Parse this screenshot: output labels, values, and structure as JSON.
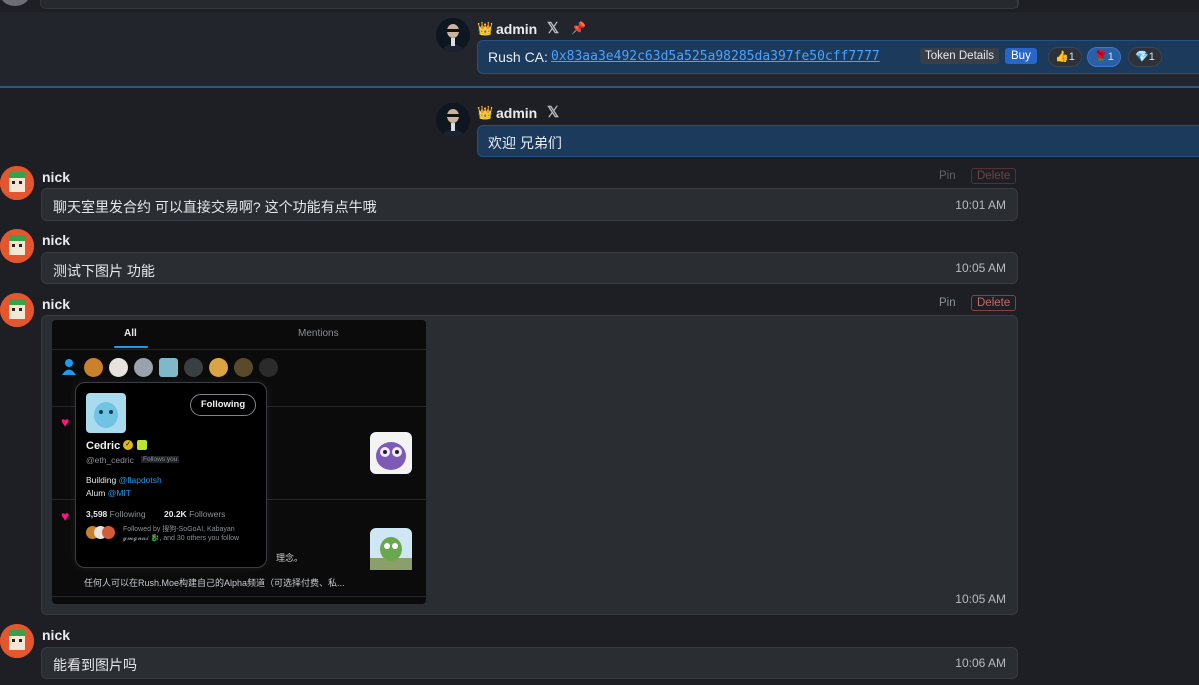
{
  "colors": {
    "background": "#1d1f24",
    "admin_bubble": "#1c3a5c",
    "message_bubble": "#2a2d32",
    "link": "#4aa3ff",
    "buy_button": "#2867c9",
    "delete_red": "#c46b6b",
    "pin_marker": "#e2424e"
  },
  "icons": {
    "crown": "crown-icon",
    "x": "x-logo-icon",
    "pin": "pin-icon"
  },
  "messages": {
    "pinned": {
      "author": "admin",
      "crown": "👑",
      "x_glyph": "𝕏",
      "pin_glyph": "📌",
      "ca_label": "Rush CA:",
      "ca_address": "0x83aa3e492c63d5a525a98285da397fe50cff7777",
      "token_details_label": "Token Details",
      "buy_label": "Buy",
      "reactions": [
        {
          "emoji": "👍",
          "count": "1"
        },
        {
          "emoji": "🌹",
          "count": "1"
        },
        {
          "emoji": "💎",
          "count": "1"
        }
      ]
    },
    "welcome": {
      "author": "admin",
      "crown": "👑",
      "x_glyph": "𝕏",
      "text": "欢迎 兄弟们"
    },
    "nick1": {
      "author": "nick",
      "text": "聊天室里发合约 可以直接交易啊?  这个功能有点牛哦",
      "time": "10:01 AM",
      "pin_label": "Pin",
      "delete_label": "Delete"
    },
    "nick2": {
      "author": "nick",
      "text": "测试下图片 功能",
      "time": "10:05 AM"
    },
    "nick3": {
      "author": "nick",
      "time": "10:05 AM",
      "pin_label": "Pin",
      "delete_label": "Delete"
    },
    "nick4": {
      "author": "nick",
      "text": "能看到图片吗",
      "time": "10:06 AM"
    }
  },
  "embedded_image": {
    "tabs": [
      "All",
      "Mentions"
    ],
    "profile": {
      "name": "Cedric",
      "handle": "@eth_cedric",
      "follows_you": "Follows you",
      "follow_button": "Following",
      "bio_line1_prefix": "Building ",
      "bio_line1_link": "@flapdotsh",
      "bio_line2_prefix": "Alum ",
      "bio_line2_link": "@MIT",
      "following_count": "3,598",
      "following_label": "Following",
      "followers_count": "20.2K",
      "followers_label": "Followers",
      "followed_by": "Followed by 搜狗-SoGoAI, Kabayan 𝓰𝓶𝓰𝓷𝓪𝓲 🐉, and 30 others you follow"
    },
    "behind_text_1": "理念。",
    "behind_text_2": "任何人可以在Rush.Moe构建自己的Alpha频道（可选择付费、私..."
  }
}
